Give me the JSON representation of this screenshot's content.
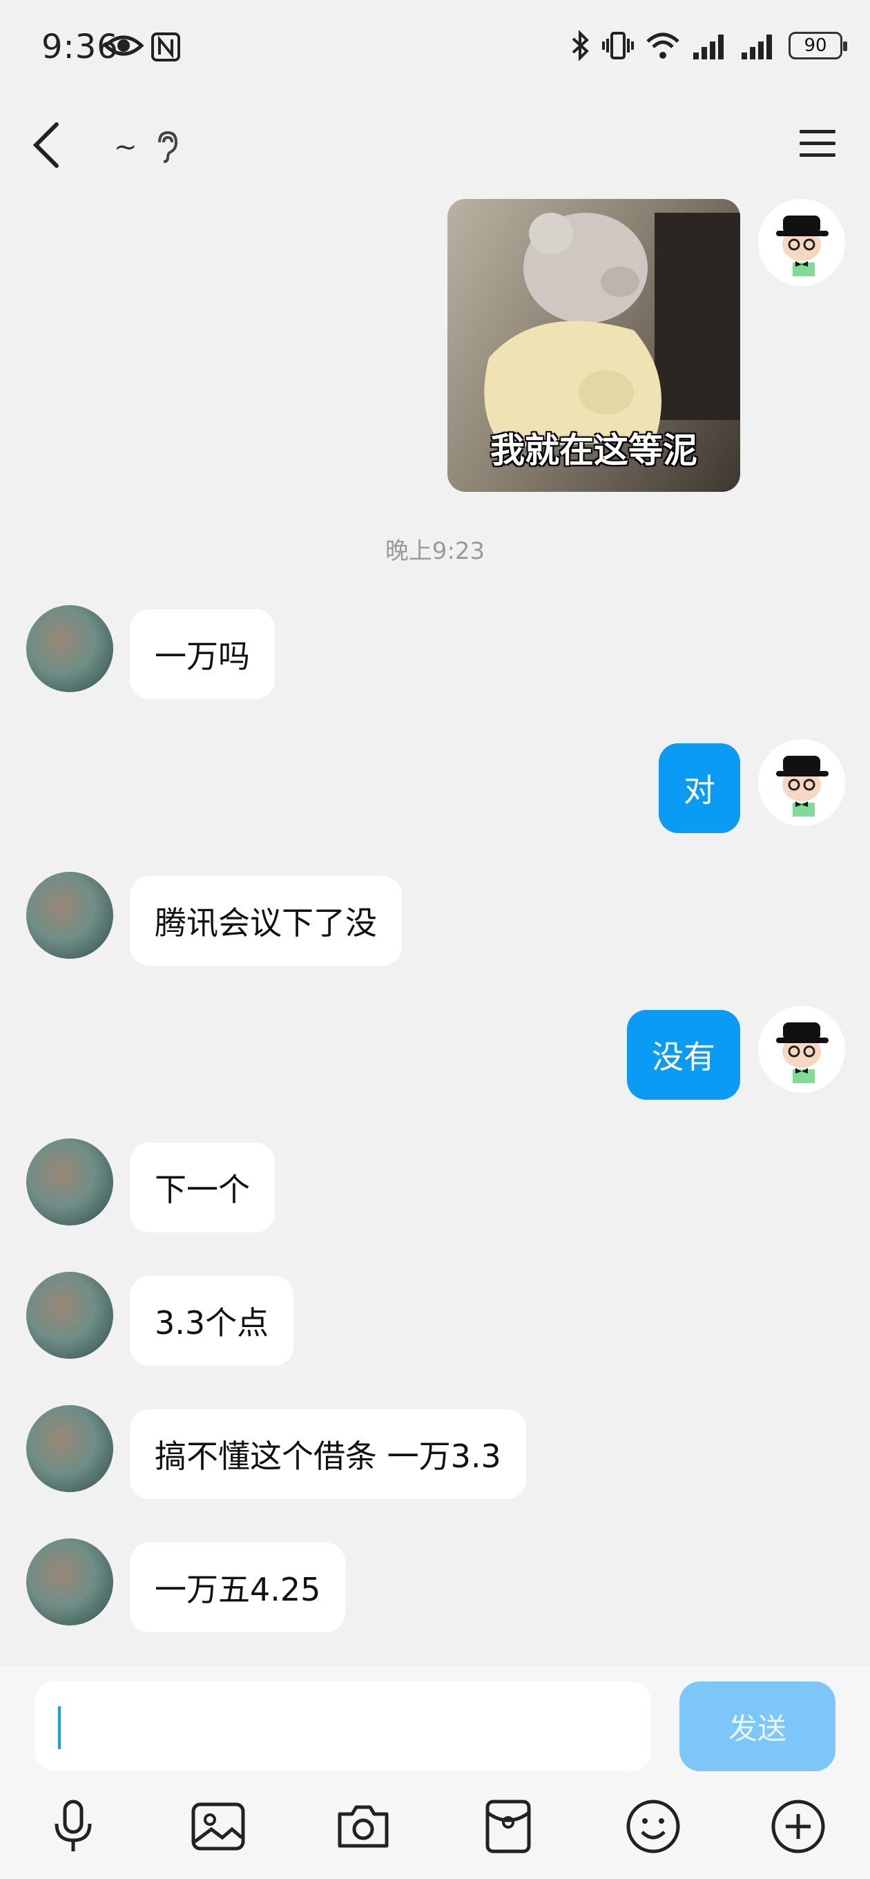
{
  "status_bar": {
    "time": "9:36",
    "battery": "90"
  },
  "header": {
    "title": "~"
  },
  "sticker": {
    "caption": "我就在这等泥"
  },
  "timestamp": "晚上9:23",
  "messages": [
    {
      "from": "them",
      "text": "一万吗"
    },
    {
      "from": "me",
      "text": "对"
    },
    {
      "from": "them",
      "text": "腾讯会议下了没"
    },
    {
      "from": "me",
      "text": "没有"
    },
    {
      "from": "them",
      "text": "下一个"
    },
    {
      "from": "them",
      "text": "3.3个点"
    },
    {
      "from": "them",
      "text": "搞不懂这个借条 一万3.3"
    },
    {
      "from": "them",
      "text": "一万五4.25"
    }
  ],
  "composer": {
    "input_value": "",
    "send_label": "发送"
  },
  "toolbar_icons": [
    "microphone-icon",
    "image-icon",
    "camera-icon",
    "red-packet-icon",
    "emoji-icon",
    "plus-icon"
  ],
  "colors": {
    "my_bubble": "#0a9bf5",
    "send_button": "#7cc6f8",
    "background": "#f1f1f1"
  }
}
